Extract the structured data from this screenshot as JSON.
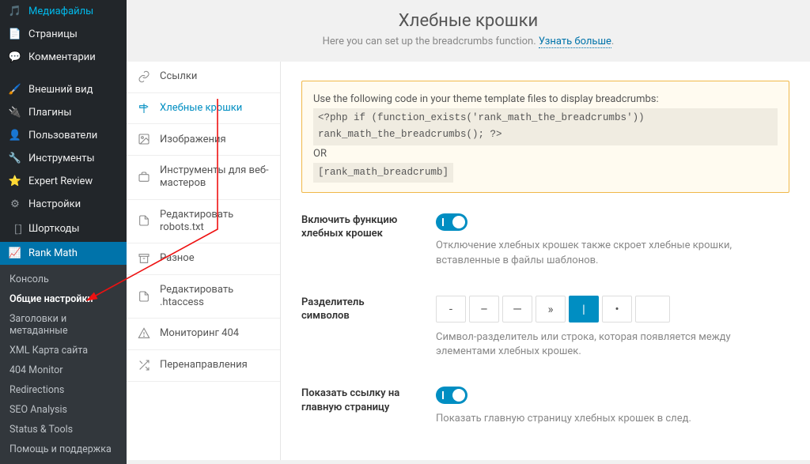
{
  "wp_menu": [
    {
      "label": "Медиафайлы"
    },
    {
      "label": "Страницы"
    },
    {
      "label": "Комментарии"
    },
    {
      "label": "Внешний вид"
    },
    {
      "label": "Плагины"
    },
    {
      "label": "Пользователи"
    },
    {
      "label": "Инструменты"
    },
    {
      "label": "Expert Review"
    },
    {
      "label": "Настройки"
    },
    {
      "label": "Шорткоды"
    },
    {
      "label": "Rank Math"
    }
  ],
  "rank_math_sub": [
    {
      "label": "Консоль"
    },
    {
      "label": "Общие настройки",
      "current": true
    },
    {
      "label": "Заголовки и метаданные"
    },
    {
      "label": "XML Карта сайта"
    },
    {
      "label": "404 Monitor"
    },
    {
      "label": "Redirections"
    },
    {
      "label": "SEO Analysis"
    },
    {
      "label": "Status & Tools"
    },
    {
      "label": "Помощь и поддержка"
    }
  ],
  "header": {
    "title": "Хлебные крошки",
    "subtitle_pre": "Here you can set up the breadcrumbs function. ",
    "subtitle_link": "Узнать больше"
  },
  "tabs": [
    {
      "label": "Ссылки"
    },
    {
      "label": "Хлебные крошки",
      "active": true
    },
    {
      "label": "Изображения"
    },
    {
      "label": "Инструменты для веб-мастеров"
    },
    {
      "label": "Редактировать robots.txt"
    },
    {
      "label": "Разное"
    },
    {
      "label": "Редактировать .htaccess"
    },
    {
      "label": "Мониторинг 404"
    },
    {
      "label": "Перенаправления"
    }
  ],
  "notice": {
    "intro": "Use the following code in your theme template files to display breadcrumbs:",
    "code1": "<?php if (function_exists('rank_math_the_breadcrumbs')) rank_math_the_breadcrumbs(); ?>",
    "or": "OR",
    "code2": "[rank_math_breadcrumb]"
  },
  "settings": {
    "enable": {
      "label": "Включить функцию хлебных крошек",
      "desc": "Отключение хлебных крошек также скроет хлебные крошки, вставленные в файлы шаблонов."
    },
    "separator": {
      "label": "Разделитель символов",
      "options": [
        "-",
        "–",
        "—",
        "»",
        "|",
        "•"
      ],
      "active_index": 4,
      "desc": "Символ-разделитель или строка, которая появляется между элементами хлебных крошек."
    },
    "homepage": {
      "label": "Показать ссылку на главную страницу",
      "desc": "Показать главную страницу хлебных крошек в след."
    }
  }
}
